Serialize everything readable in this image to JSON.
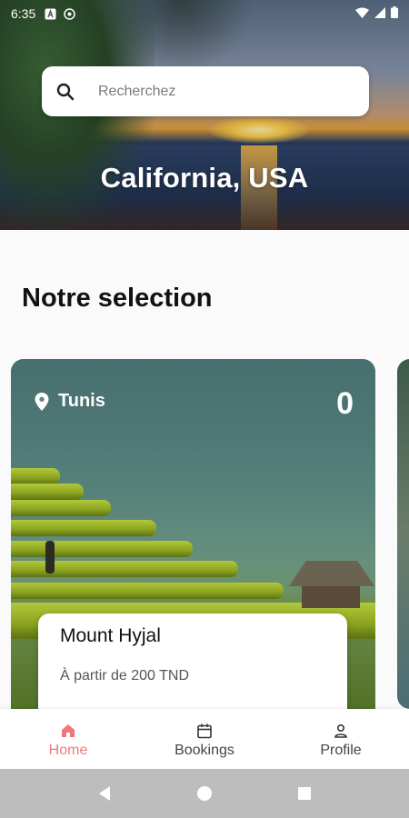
{
  "status_bar": {
    "time": "6:35",
    "left_icons": [
      "a-badge-icon",
      "at-sign-icon"
    ],
    "right_icons": [
      "wifi-icon",
      "signal-icon",
      "battery-icon"
    ]
  },
  "hero": {
    "title": "California, USA"
  },
  "search": {
    "placeholder": "Recherchez",
    "value": ""
  },
  "section": {
    "title": "Notre selection"
  },
  "cards": [
    {
      "location": "Tunis",
      "count": "0",
      "name": "Mount Hyjal",
      "price": "À partir de 200 TND"
    }
  ],
  "bottom_nav": {
    "items": [
      {
        "label": "Home",
        "icon": "home-icon",
        "active": true
      },
      {
        "label": "Bookings",
        "icon": "calendar-icon",
        "active": false
      },
      {
        "label": "Profile",
        "icon": "person-icon",
        "active": false
      }
    ],
    "active_color": "#f0787a"
  },
  "system_nav": {
    "icons": [
      "back-icon",
      "home-circle-icon",
      "recents-icon"
    ]
  }
}
